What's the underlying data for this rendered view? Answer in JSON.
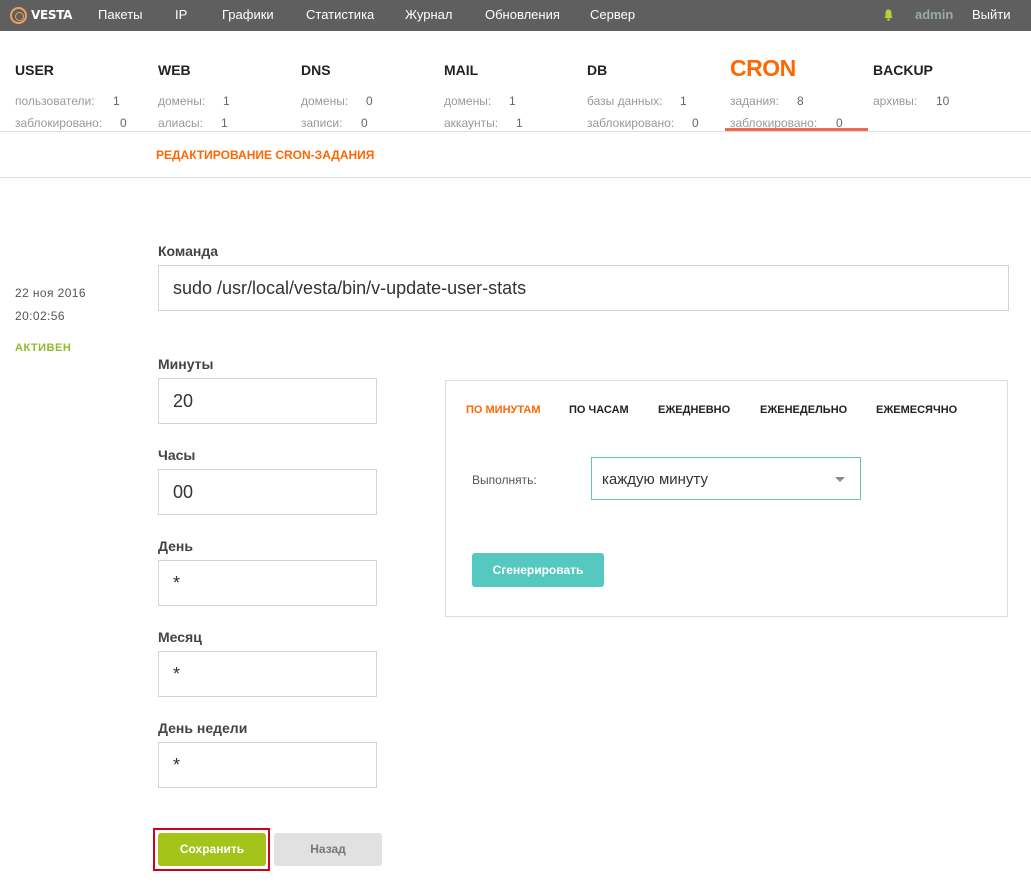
{
  "topbar": {
    "logo_text": "VESTA",
    "nav": [
      "Пакеты",
      "IP",
      "Графики",
      "Статистика",
      "Журнал",
      "Обновления",
      "Сервер"
    ],
    "user": "admin",
    "logout": "Выйти"
  },
  "stats": [
    {
      "title": "USER",
      "rows": [
        {
          "label": "пользователи:",
          "value": "1"
        },
        {
          "label": "заблокировано:",
          "value": "0"
        }
      ]
    },
    {
      "title": "WEB",
      "rows": [
        {
          "label": "домены:",
          "value": "1"
        },
        {
          "label": "алиасы:",
          "value": "1"
        }
      ]
    },
    {
      "title": "DNS",
      "rows": [
        {
          "label": "домены:",
          "value": "0"
        },
        {
          "label": "записи:",
          "value": "0"
        }
      ]
    },
    {
      "title": "MAIL",
      "rows": [
        {
          "label": "домены:",
          "value": "1"
        },
        {
          "label": "аккаунты:",
          "value": "1"
        }
      ]
    },
    {
      "title": "DB",
      "rows": [
        {
          "label": "базы данных:",
          "value": "1"
        },
        {
          "label": "заблокировано:",
          "value": "0"
        }
      ]
    },
    {
      "title": "CRON",
      "rows": [
        {
          "label": "задания:",
          "value": "8"
        },
        {
          "label": "заблокировано:",
          "value": "0"
        }
      ]
    },
    {
      "title": "BACKUP",
      "rows": [
        {
          "label": "архивы:",
          "value": "10"
        }
      ]
    }
  ],
  "page_title": "РЕДАКТИРОВАНИЕ CRON-ЗАДАНИЯ",
  "meta": {
    "date": "22  ноя  2016",
    "time": "20:02:56",
    "status": "АКТИВЕН"
  },
  "form": {
    "command_label": "Команда",
    "command_value": "sudo /usr/local/vesta/bin/v-update-user-stats",
    "minutes_label": "Минуты",
    "minutes_value": "20",
    "hours_label": "Часы",
    "hours_value": "00",
    "day_label": "День",
    "day_value": "*",
    "month_label": "Месяц",
    "month_value": "*",
    "weekday_label": "День недели",
    "weekday_value": "*"
  },
  "generator": {
    "tabs": [
      "ПО МИНУТАМ",
      "ПО ЧАСАМ",
      "ЕЖЕДНЕВНО",
      "ЕЖЕНЕДЕЛЬНО",
      "ЕЖЕМЕСЯЧНО"
    ],
    "run_label": "Выполнять:",
    "run_value": "каждую минуту",
    "generate_label": "Сгенерировать"
  },
  "buttons": {
    "save": "Сохранить",
    "back": "Назад"
  },
  "colors": {
    "accent": "#ff6701",
    "status_green": "#8fba2b",
    "save_green": "#a5c31a",
    "teal": "#55c9c0"
  }
}
